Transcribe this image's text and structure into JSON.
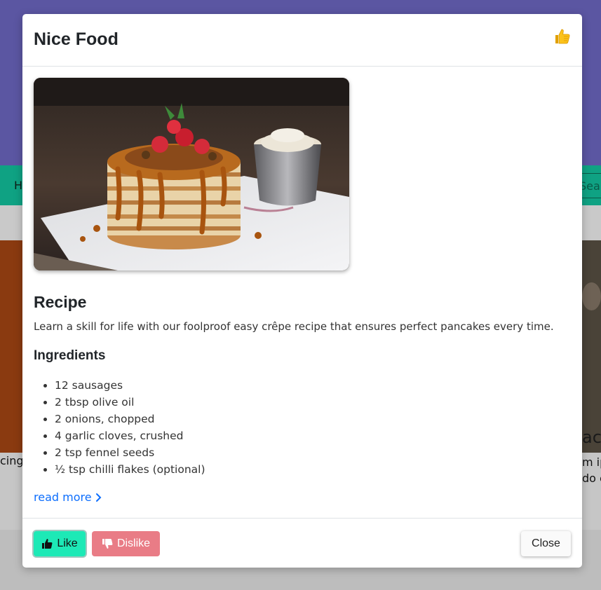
{
  "background": {
    "nav_left_text": "H",
    "nav_search_text": "Sear",
    "card_left_caption": "cing",
    "card_right_title": "ac",
    "card_right_line1": "m ip",
    "card_right_line2": "do e"
  },
  "modal": {
    "title": "Nice Food",
    "header_icon": "thumbs-up-emoji",
    "image_alt": "Stack of pancakes with caramel sauce and strawberries",
    "recipe": {
      "heading": "Recipe",
      "description": "Learn a skill for life with our foolproof easy crêpe recipe that ensures perfect pancakes every time."
    },
    "ingredients": {
      "heading": "Ingredients",
      "items": [
        "12 sausages",
        "2 tbsp olive oil",
        "2 onions, chopped",
        "4 garlic cloves, crushed",
        "2 tsp fennel seeds",
        "½ tsp chilli flakes (optional)"
      ]
    },
    "read_more": "read more",
    "footer": {
      "like_label": "Like",
      "dislike_label": "Dislike",
      "close_label": "Close"
    }
  },
  "colors": {
    "like_bg": "#1de9b6",
    "dislike_bg": "#e97c86",
    "link": "#0d6efd",
    "hero_bg": "#5b56a2",
    "nav_bg": "#0fa283"
  }
}
